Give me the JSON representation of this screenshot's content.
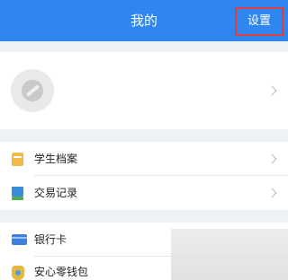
{
  "header": {
    "title": "我的",
    "settings_label": "设置",
    "bg_color": "#2f86f0",
    "highlight_color": "#e23b3b"
  },
  "profile": {
    "avatar_icon": "avatar-placeholder-icon",
    "chevron_icon": "chevron-right-icon"
  },
  "menu_group1": [
    {
      "label": "学生档案",
      "icon": "archive-icon"
    },
    {
      "label": "交易记录",
      "icon": "records-icon"
    }
  ],
  "menu_group2": [
    {
      "label": "银行卡",
      "icon": "bank-card-icon"
    },
    {
      "label": "安心零钱包",
      "icon": "wallet-icon"
    }
  ]
}
